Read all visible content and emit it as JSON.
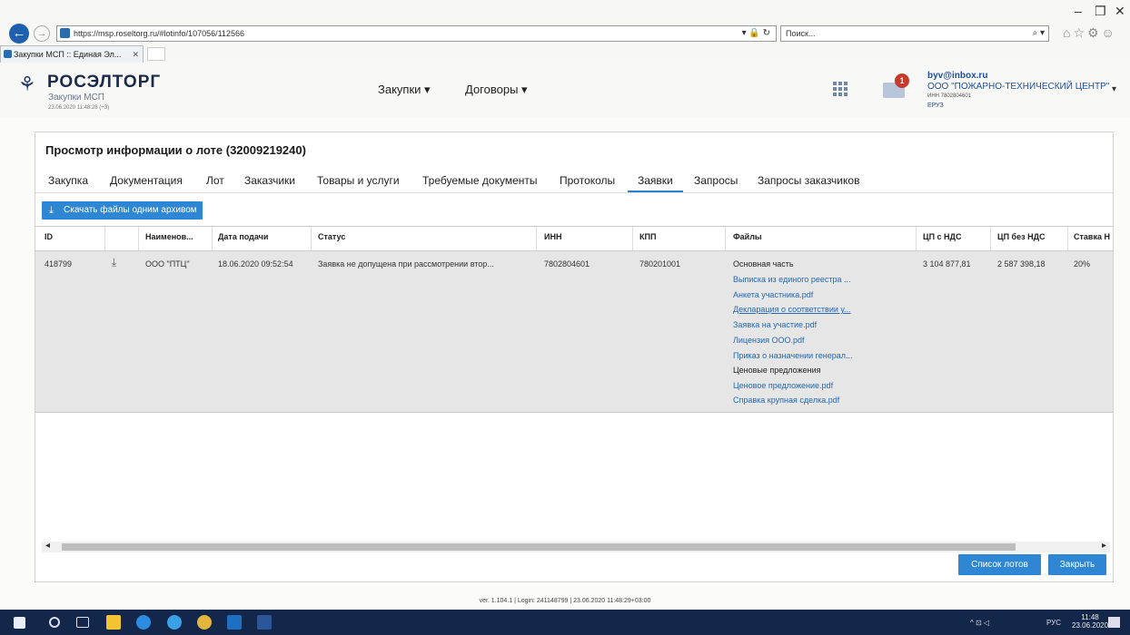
{
  "browser": {
    "url": "https://msp.roseltorg.ru/#lotinfo/107056/112566",
    "search_placeholder": "Поиск...",
    "tab_title": "Закупки МСП :: Единая Эл...",
    "addr_tools": "▾ 🔒 ↻",
    "search_icon": "search-icon",
    "win_minimize": "–",
    "win_restore": "❐",
    "win_close": "✕",
    "ie_icons": "⌂☆⚙☺",
    "tab_close": "✕"
  },
  "header": {
    "logo_title": "РОСЭЛТОРГ",
    "logo_sub": "Закупки МСП",
    "logo_date": "23.06.2020 11:48:28 (+3)",
    "nav": [
      {
        "label": "Закупки ▾"
      },
      {
        "label": "Договоры ▾"
      }
    ],
    "mail_badge": "1",
    "user": {
      "email": "byv@inbox.ru",
      "org": "ООО \"ПОЖАРНО-ТЕХНИЧЕСКИЙ ЦЕНТР\"",
      "inn": "ИНН 7802804601",
      "role": "ЕРУЗ"
    }
  },
  "panel": {
    "title": "Просмотр информации о лоте (32009219240)",
    "tabs": [
      {
        "label": "Закупка"
      },
      {
        "label": "Документация"
      },
      {
        "label": "Лот"
      },
      {
        "label": "Заказчики"
      },
      {
        "label": "Товары и услуги"
      },
      {
        "label": "Требуемые документы"
      },
      {
        "label": "Протоколы"
      },
      {
        "label": "Заявки"
      },
      {
        "label": "Запросы"
      },
      {
        "label": "Запросы заказчиков"
      }
    ],
    "active_tab": "Заявки",
    "download_label": "Скачать файлы одним архивом",
    "columns": [
      "ID",
      "Наименов...",
      "Дата подачи",
      "Статус",
      "ИНН",
      "КПП",
      "Файлы",
      "ЦП с НДС",
      "ЦП без НДС",
      "Ставка Н"
    ],
    "row": {
      "id": "418799",
      "name": "ООО \"ПТЦ\"",
      "date": "18.06.2020 09:52:54",
      "status": "Заявка не допущена при рассмотрении втор...",
      "inn": "7802804601",
      "kpp": "780201001",
      "price_vat": "3 104 877,81",
      "price_novat": "2 587 398,18",
      "rate": "20%",
      "files": [
        "Основная часть",
        "Выписка из единого реестра ...",
        "Анкета участника.pdf",
        "Декларация о соответствии у...",
        "Заявка на участие.pdf",
        "Лицензия ООО.pdf",
        "Приказ о назначении генерал...",
        "Ценовые предложения",
        "Ценовое предложение.pdf",
        "Справка крупная сделка.pdf"
      ]
    },
    "btn_lots": "Список лотов",
    "btn_close": "Закрыть"
  },
  "footer": {
    "version": "ver. 1.104.1 | Login: 241148799 | 23.06.2020 11:48:29+03:00"
  },
  "taskbar": {
    "lang": "РУС",
    "tray": "^ ⊡ ◁ ",
    "time": "11:48",
    "date": "23.06.2020"
  }
}
